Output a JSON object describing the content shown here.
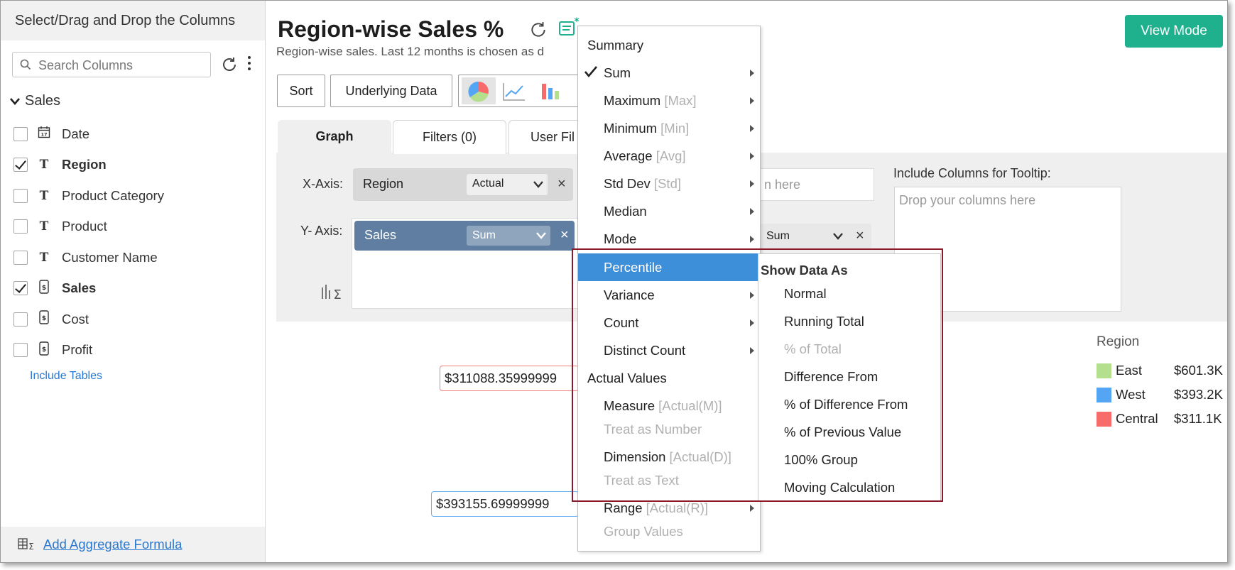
{
  "sidebar": {
    "header": "Select/Drag and Drop the Columns",
    "search_placeholder": "Search Columns",
    "group": "Sales",
    "columns": [
      {
        "label": "Date",
        "checked": false,
        "icon": "calendar-icon"
      },
      {
        "label": "Region",
        "checked": true,
        "icon": "text-type-icon"
      },
      {
        "label": "Product Category",
        "checked": false,
        "icon": "text-type-icon"
      },
      {
        "label": "Product",
        "checked": false,
        "icon": "text-type-icon"
      },
      {
        "label": "Customer Name",
        "checked": false,
        "icon": "text-type-icon"
      },
      {
        "label": "Sales",
        "checked": true,
        "icon": "currency-icon"
      },
      {
        "label": "Cost",
        "checked": false,
        "icon": "currency-icon"
      },
      {
        "label": "Profit",
        "checked": false,
        "icon": "currency-icon"
      }
    ],
    "include_tables": "Include Tables",
    "add_aggregate": "Add Aggregate Formula"
  },
  "header": {
    "title": "Region-wise Sales %",
    "subtitle": "Region-wise sales. Last 12 months is chosen as d",
    "view_mode": "View Mode"
  },
  "toolbar": {
    "sort": "Sort",
    "underlying_data": "Underlying Data",
    "type_glyph": "T"
  },
  "tabs": [
    "Graph",
    "Filters (0)",
    "User Fil"
  ],
  "axes": {
    "x_label": "X-Axis:",
    "y_label": "Y- Axis:",
    "x_column": "Region",
    "x_mode": "Actual",
    "y_column": "Sales",
    "y_mode": "Sum",
    "right_drop_placeholder": "n here",
    "right_y_mode": "Sum",
    "tooltip_label": "Include Columns for Tooltip:",
    "tooltip_placeholder": "Drop your columns here",
    "remove": "×"
  },
  "data_labels": {
    "central": "$311088.35999999",
    "west": "$393155.69999999"
  },
  "legend": {
    "title": "Region",
    "items": [
      {
        "name": "East",
        "value": "$601.3K",
        "color": "#b4e08d"
      },
      {
        "name": "West",
        "value": "$393.2K",
        "color": "#55a5f5"
      },
      {
        "name": "Central",
        "value": "$311.1K",
        "color": "#f76b6b"
      }
    ]
  },
  "summary_menu": {
    "summary_header": "Summary",
    "items": [
      {
        "label": "Sum",
        "hint": "",
        "checked": true,
        "arrow": true
      },
      {
        "label": "Maximum",
        "hint": "[Max]",
        "arrow": true
      },
      {
        "label": "Minimum",
        "hint": "[Min]",
        "arrow": true
      },
      {
        "label": "Average",
        "hint": "[Avg]",
        "arrow": true
      },
      {
        "label": "Std Dev",
        "hint": "[Std]",
        "arrow": true
      },
      {
        "label": "Median",
        "hint": "",
        "arrow": true
      },
      {
        "label": "Mode",
        "hint": "",
        "arrow": true
      },
      {
        "label": "Percentile",
        "hint": "",
        "highlighted": true
      },
      {
        "label": "Variance",
        "hint": "",
        "arrow": true
      },
      {
        "label": "Count",
        "hint": "",
        "arrow": true
      },
      {
        "label": "Distinct Count",
        "hint": "",
        "arrow": true
      }
    ],
    "actual_header": "Actual Values",
    "actual_items": [
      {
        "label": "Measure",
        "hint": "[Actual(M)]"
      },
      {
        "label": "Treat as Number",
        "disabled": true
      },
      {
        "label": "Dimension",
        "hint": "[Actual(D)]"
      },
      {
        "label": "Treat as Text",
        "disabled": true
      },
      {
        "label": "Range",
        "hint": "[Actual(R)]",
        "arrow": true
      },
      {
        "label": "Group Values",
        "disabled": true
      }
    ]
  },
  "show_data_menu": {
    "header": "Show Data As",
    "items": [
      {
        "label": "Normal"
      },
      {
        "label": "Running Total"
      },
      {
        "label": "% of Total",
        "disabled": true
      },
      {
        "label": "Difference From"
      },
      {
        "label": "% of Difference From"
      },
      {
        "label": "% of Previous Value"
      },
      {
        "label": "100% Group"
      },
      {
        "label": "Moving Calculation"
      }
    ]
  }
}
